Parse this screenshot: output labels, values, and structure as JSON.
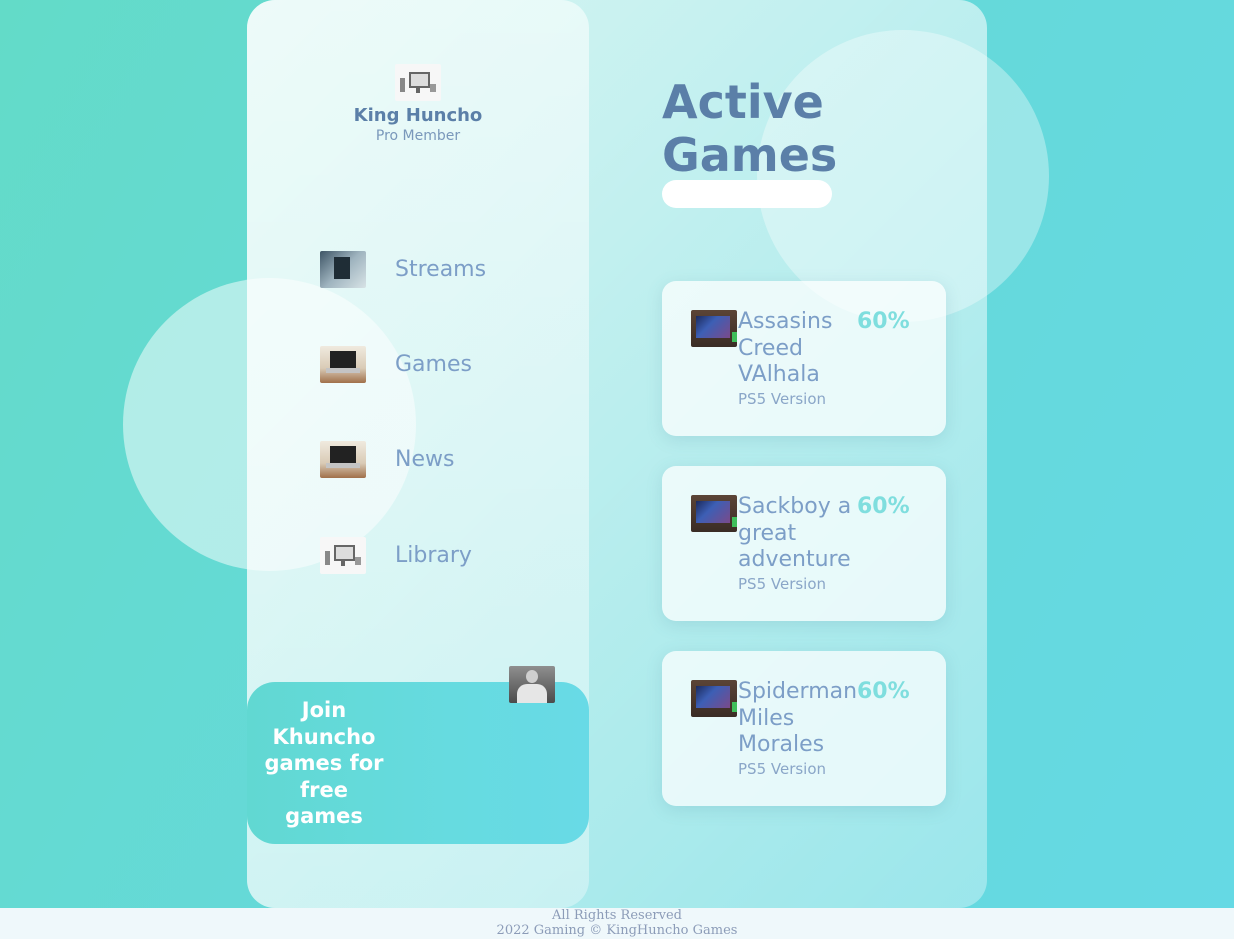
{
  "profile": {
    "avatar_icon": "desktop-computer-icon",
    "name": "King Huncho",
    "membership": "Pro Member"
  },
  "nav": {
    "items": [
      {
        "label": "Streams",
        "icon": "streaming-setup-icon"
      },
      {
        "label": "Games",
        "icon": "laptop-icon"
      },
      {
        "label": "News",
        "icon": "laptop-icon"
      },
      {
        "label": "Library",
        "icon": "desktop-computer-icon"
      }
    ]
  },
  "join": {
    "text": "Join Khuncho games for free games",
    "avatar_icon": "user-avatar-icon"
  },
  "main": {
    "title": "Active Games",
    "games": [
      {
        "title": "Assasins Creed VAlhala",
        "platform": "PS5 Version",
        "progress": "60%"
      },
      {
        "title": "Sackboy a great adventure",
        "platform": "PS5 Version",
        "progress": "60%"
      },
      {
        "title": "Spiderman Miles Morales",
        "platform": "PS5 Version",
        "progress": "60%"
      }
    ]
  },
  "footer": {
    "line1": "All Rights Reserved",
    "line2": "2022 Gaming © KingHuncho Games"
  },
  "colors": {
    "background": "#65d9d8",
    "accent_text": "#5b7fa8",
    "nav_text": "#7c9ec7",
    "progress": "#7fdede",
    "join_card": "#66dbe0"
  }
}
